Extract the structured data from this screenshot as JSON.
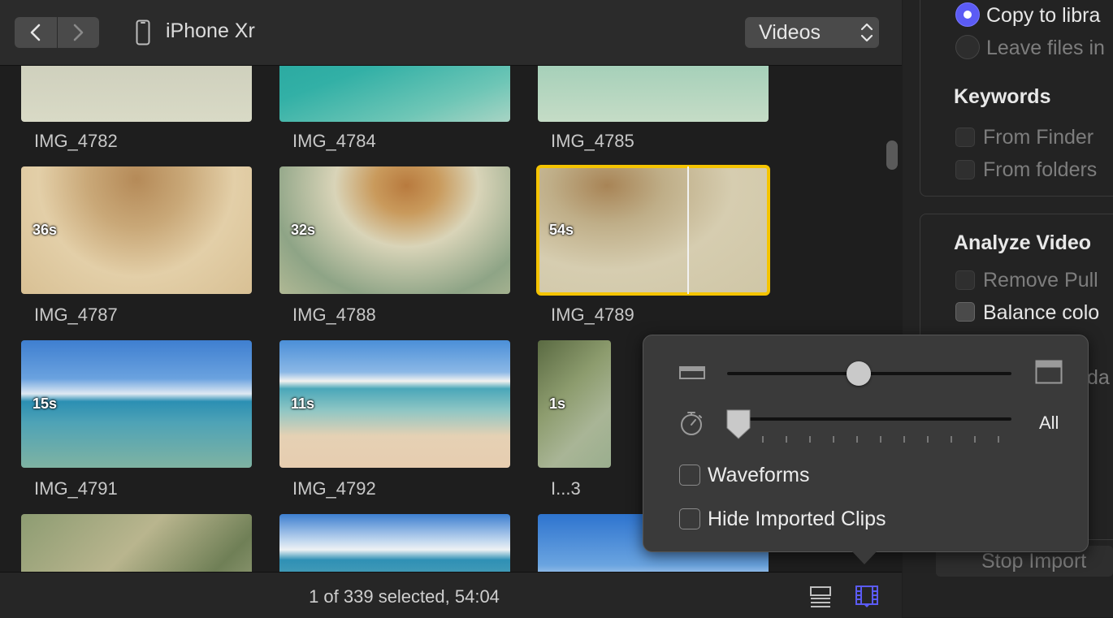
{
  "toolbar": {
    "device_name": "iPhone Xr",
    "media_filter": "Videos"
  },
  "clips": [
    {
      "name": "IMG_4782",
      "duration": ""
    },
    {
      "name": "IMG_4784",
      "duration": ""
    },
    {
      "name": "IMG_4785",
      "duration": ""
    },
    {
      "name": "IMG_4787",
      "duration": "36s"
    },
    {
      "name": "IMG_4788",
      "duration": "32s"
    },
    {
      "name": "IMG_4789",
      "duration": "54s"
    },
    {
      "name": "IMG_4791",
      "duration": "15s"
    },
    {
      "name": "IMG_4792",
      "duration": "11s"
    },
    {
      "name": "I...3",
      "duration": "1s"
    }
  ],
  "status": {
    "text": "1 of 339 selected, 54:04"
  },
  "import_options": {
    "copy_label": "Copy to libra",
    "leave_label": "Leave files in",
    "keywords_heading": "Keywords",
    "from_finder": "From Finder",
    "from_folders": "From folders",
    "analyze_heading": "Analyze Video",
    "remove_pulldown": "Remove Pull",
    "balance_color": "Balance colo",
    "partial_label": "da",
    "stop_import": "Stop Import"
  },
  "popover": {
    "duration_label": "All",
    "waveforms_label": "Waveforms",
    "hide_imported_label": "Hide Imported Clips",
    "clip_height": 0.44,
    "duration_steps": 0
  },
  "colors": {
    "accent": "#5b5bf5",
    "selection": "#f5c400",
    "panel": "#2b2b2b"
  }
}
